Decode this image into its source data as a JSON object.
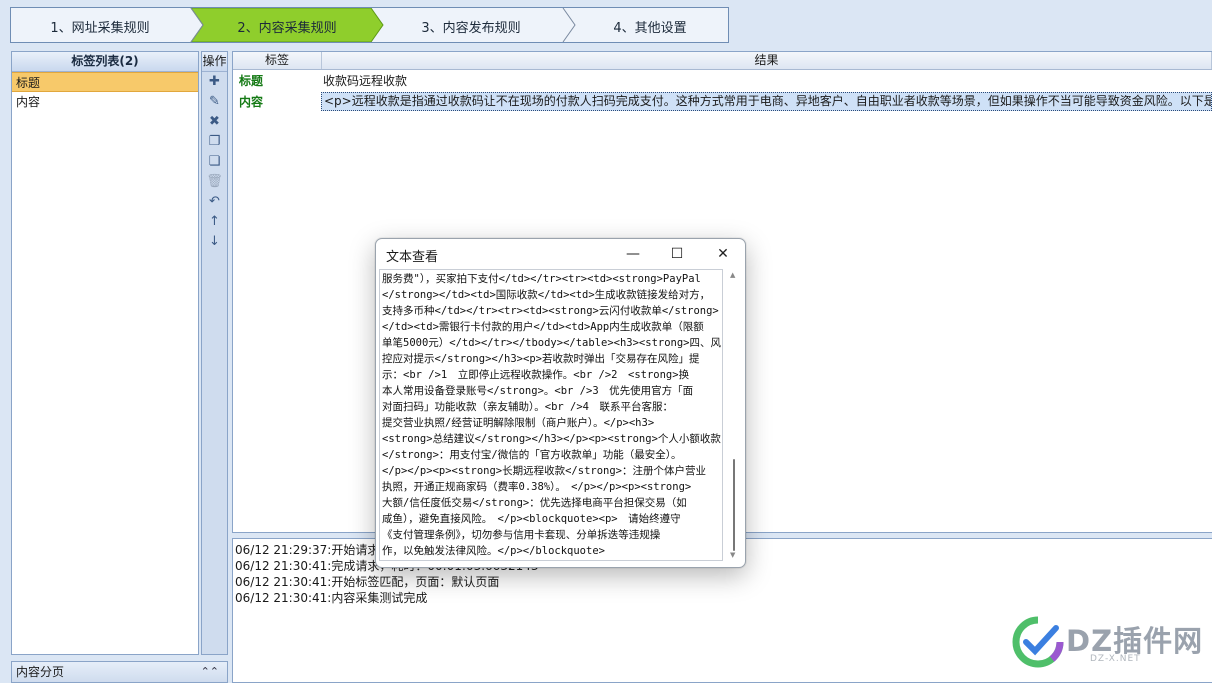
{
  "steps": [
    {
      "label": "1、网址采集规则",
      "active": false
    },
    {
      "label": "2、内容采集规则",
      "active": true
    },
    {
      "label": "3、内容发布规则",
      "active": false
    },
    {
      "label": "4、其他设置",
      "active": false
    }
  ],
  "left_panel": {
    "title": "标签列表(2)",
    "items": [
      "标题",
      "内容"
    ]
  },
  "ops": {
    "title": "操作",
    "buttons": [
      {
        "icon": "plus-icon",
        "glyph": "✚"
      },
      {
        "icon": "pencil-icon",
        "glyph": "✎"
      },
      {
        "icon": "delete-x-icon",
        "glyph": "✖"
      },
      {
        "icon": "copy-icon",
        "glyph": "❐"
      },
      {
        "icon": "paste-icon",
        "glyph": "❏"
      },
      {
        "icon": "trash-icon",
        "glyph": "🗑"
      },
      {
        "icon": "undo-icon",
        "glyph": "↶"
      },
      {
        "icon": "arrow-up-icon",
        "glyph": "↑"
      },
      {
        "icon": "arrow-down-icon",
        "glyph": "↓"
      }
    ]
  },
  "paging": {
    "label": "内容分页",
    "chevron": "⌃⌃"
  },
  "results": {
    "headers": {
      "tag": "标签",
      "result": "结果"
    },
    "rows": [
      {
        "tag": "标题",
        "value": "收款码远程收款"
      },
      {
        "tag": "内容",
        "value": "<p>远程收款是指通过收款码让不在现场的付款人扫码完成支付。这种方式常用于电商、异地客户、自由职业者收款等场景，但如果操作不当可能导致资金风险。以下是<"
      }
    ]
  },
  "log": [
    "06/12 21:29:37:开始请求",
    "06/12 21:30:41:完成请求，耗时：00:01:03.6632143",
    "06/12 21:30:41:开始标签匹配，页面：默认页面",
    "06/12 21:30:41:内容采集测试完成"
  ],
  "dialog": {
    "title": "文本查看",
    "minimize": "—",
    "maximize": "☐",
    "close": "✕",
    "lines": [
      "服务费\"），买家拍下支付</td></tr><tr><td><strong>PayPal",
      "</strong></td><td>国际收款</td><td>生成收款链接发给对方，",
      "支持多币种</td></tr><tr><td><strong>云闪付收款单</strong>",
      "</td><td>需银行卡付款的用户</td><td>App内生成收款单（限额",
      "单笔5000元）</td></tr></tbody></table><h3><strong>四、风",
      "控应对提示</strong></h3><p>若收款时弹出「交易存在风险」提",
      "示：<br />1　立即停止远程收款操作。<br />2　<strong>换",
      "本人常用设备登录账号</strong>。<br />3　优先使用官方「面",
      "对面扫码」功能收款（亲友辅助）。<br />4　联系平台客服：",
      "提交营业执照/经营证明解除限制（商户账户）。</p><h3>",
      "<strong>总结建议</strong></h3></p><p><strong>个人小额收款",
      "</strong>：用支付宝/微信的「官方收款单」功能（最安全）。",
      "</p></p><p><strong>长期远程收款</strong>：注册个体户营业",
      "执照，开通正规商家码（费率0.38%）。　</p></p><p><strong>",
      "大额/信任度低交易</strong>：优先选择电商平台担保交易（如",
      "咸鱼），避免直接风险。　</p><blockquote><p>　请始终遵守",
      "《支付管理条例》，切勿参与信用卡套现、分单拆迭等违规操",
      "作，以免触发法律风险。</p></blockquote>"
    ]
  },
  "watermark": {
    "text": "DZ插件网",
    "sub": "DZ-X.NET",
    "colors": {
      "green": "#4fbf6a",
      "blue": "#3b7fe0",
      "purple": "#9b59d0"
    }
  }
}
